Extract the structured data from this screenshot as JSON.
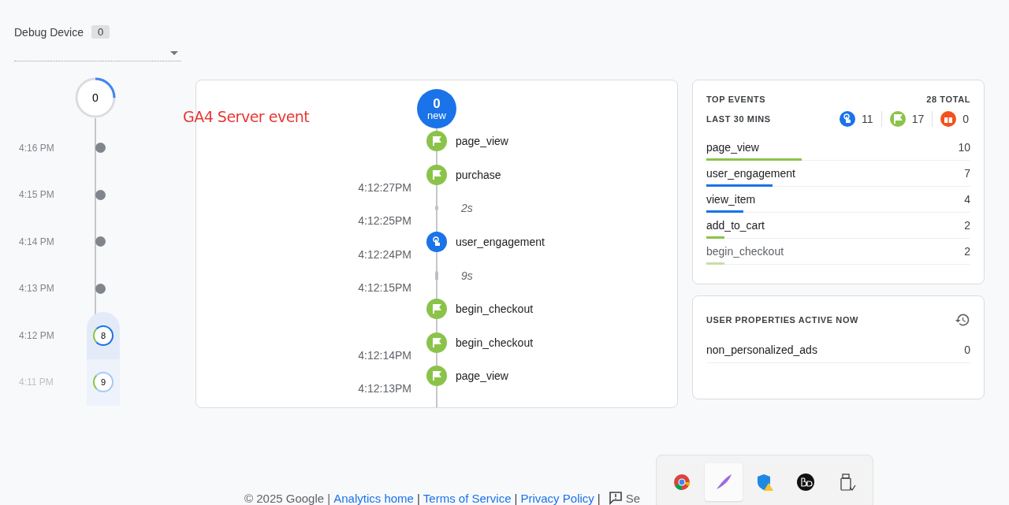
{
  "debug_device": {
    "label": "Debug Device",
    "count": "0"
  },
  "annotation": "GA4 Server event",
  "minutes": {
    "top_count": "0",
    "items": [
      {
        "time": "4:16 PM",
        "kind": "dot"
      },
      {
        "time": "4:15 PM",
        "kind": "dot"
      },
      {
        "time": "4:14 PM",
        "kind": "dot"
      },
      {
        "time": "4:13 PM",
        "kind": "dot"
      },
      {
        "time": "4:12 PM",
        "kind": "count",
        "count": "8",
        "selected": true
      },
      {
        "time": "4:11 PM",
        "kind": "count",
        "count": "9",
        "selected": false
      }
    ]
  },
  "stream": {
    "new_count": "0",
    "new_label": "new",
    "items": [
      {
        "kind": "conversion",
        "name": "page_view"
      },
      {
        "kind": "conversion",
        "name": "purchase",
        "time": "4:12:27PM"
      },
      {
        "kind": "gap",
        "name": "2s",
        "time": "4:12:25PM"
      },
      {
        "kind": "engagement",
        "name": "user_engagement",
        "time": "4:12:24PM"
      },
      {
        "kind": "gap",
        "name": "9s",
        "time": "4:12:15PM"
      },
      {
        "kind": "conversion",
        "name": "begin_checkout"
      },
      {
        "kind": "conversion",
        "name": "begin_checkout",
        "time": "4:12:14PM"
      },
      {
        "kind": "conversion",
        "name": "page_view",
        "time": "4:12:13PM"
      }
    ]
  },
  "top_events": {
    "title": "TOP EVENTS",
    "total": "28 TOTAL",
    "period": "LAST 30 MINS",
    "counts": [
      {
        "kind": "engagement",
        "value": "11"
      },
      {
        "kind": "conversion",
        "value": "17"
      },
      {
        "kind": "error",
        "value": "0"
      }
    ],
    "rows": [
      {
        "name": "page_view",
        "value": "10",
        "level": 0.36,
        "color": "#8bc34a"
      },
      {
        "name": "user_engagement",
        "value": "7",
        "level": 0.25,
        "color": "#1a73e8"
      },
      {
        "name": "view_item",
        "value": "4",
        "level": 0.14,
        "color": "#1a73e8"
      },
      {
        "name": "add_to_cart",
        "value": "2",
        "level": 0.07,
        "color": "#8bc34a"
      },
      {
        "name": "begin_checkout",
        "value": "2",
        "level": 0.07,
        "color": "#c5e1a5"
      }
    ]
  },
  "user_properties": {
    "title": "USER PROPERTIES ACTIVE NOW",
    "rows": [
      {
        "name": "non_personalized_ads",
        "value": "0"
      }
    ]
  },
  "footer": {
    "copyright": "© 2025 Google |",
    "links": [
      {
        "label": "Analytics home",
        "separator": "|"
      },
      {
        "label": "Terms of Service",
        "separator": "|"
      },
      {
        "label": "Privacy Policy",
        "separator": "|"
      }
    ],
    "feedback": "Se"
  },
  "tray": {
    "items": [
      {
        "kind": "browser",
        "selected": false
      },
      {
        "kind": "quill",
        "selected": true
      },
      {
        "kind": "shield",
        "selected": false
      },
      {
        "kind": "audio",
        "selected": false
      },
      {
        "kind": "usb",
        "selected": false
      }
    ]
  }
}
